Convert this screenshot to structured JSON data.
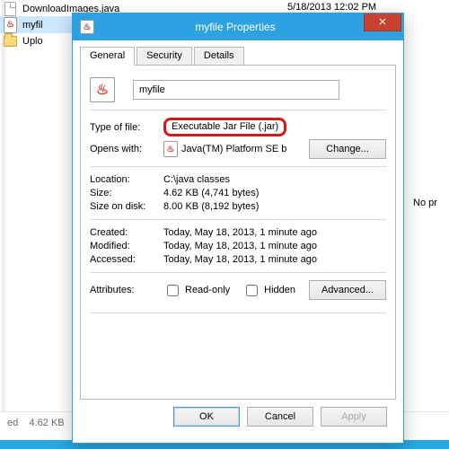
{
  "explorer": {
    "rows": [
      {
        "name": "DownloadImages.java",
        "date": "5/18/2013 12:02 PM",
        "iconType": "page"
      },
      {
        "name": "myfil",
        "date": "",
        "iconType": "java",
        "selected": true
      },
      {
        "name": "Uplo",
        "date": "",
        "iconType": "folder"
      }
    ],
    "status_prefix": "ed",
    "status_size": "4.62 KB",
    "sidebar_note": "No pr"
  },
  "dialog": {
    "title": "myfile Properties",
    "close_glyph": "✕",
    "tabs": {
      "general": "General",
      "security": "Security",
      "details": "Details"
    },
    "filename": "myfile",
    "labels": {
      "type": "Type of file:",
      "opens": "Opens with:",
      "location": "Location:",
      "size": "Size:",
      "ondisk": "Size on disk:",
      "created": "Created:",
      "modified": "Modified:",
      "accessed": "Accessed:",
      "attributes": "Attributes:"
    },
    "values": {
      "type": "Executable Jar File (.jar)",
      "opens": "Java(TM) Platform SE b",
      "location": "C:\\java classes",
      "size": "4.62 KB (4,741 bytes)",
      "ondisk": "8.00 KB (8,192 bytes)",
      "created": "Today, May 18, 2013, 1 minute ago",
      "modified": "Today, May 18, 2013, 1 minute ago",
      "accessed": "Today, May 18, 2013, 1 minute ago"
    },
    "attributes": {
      "readonly": "Read-only",
      "hidden": "Hidden"
    },
    "buttons": {
      "change": "Change...",
      "advanced": "Advanced...",
      "ok": "OK",
      "cancel": "Cancel",
      "apply": "Apply"
    },
    "java_glyph": "♨"
  }
}
